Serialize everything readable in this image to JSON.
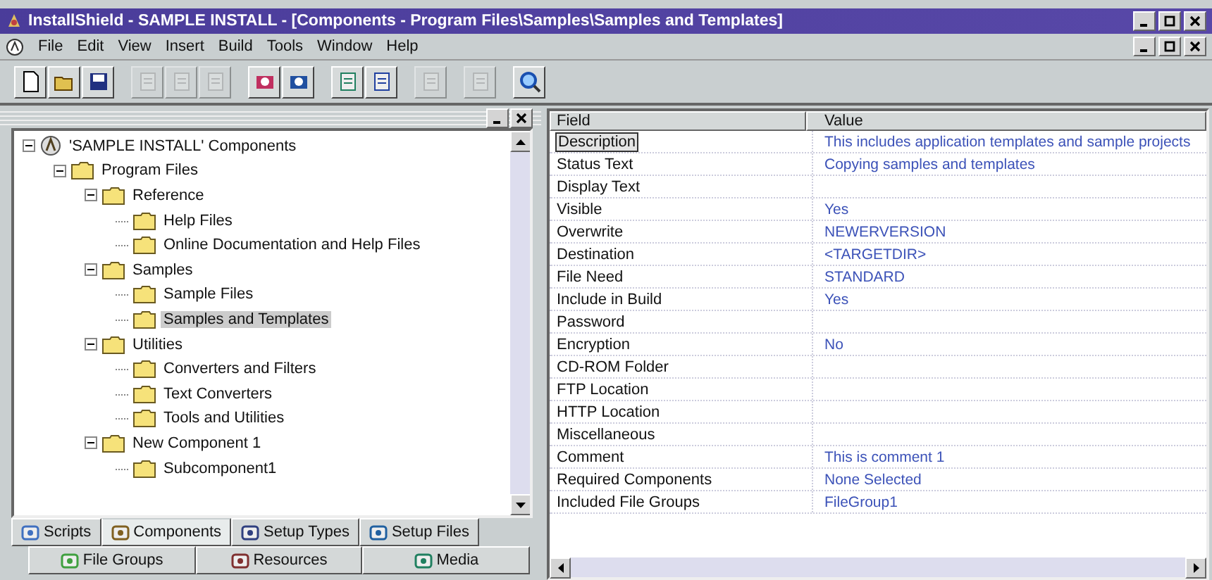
{
  "window": {
    "title": "InstallShield - SAMPLE INSTALL - [Components - Program Files\\Samples\\Samples and Templates]"
  },
  "menu": [
    "File",
    "Edit",
    "View",
    "Insert",
    "Build",
    "Tools",
    "Window",
    "Help"
  ],
  "toolbar": [
    {
      "kind": "new",
      "disabled": false
    },
    {
      "kind": "open",
      "disabled": false
    },
    {
      "kind": "save",
      "disabled": false
    },
    {
      "kind": "cut",
      "disabled": true
    },
    {
      "kind": "copy",
      "disabled": true
    },
    {
      "kind": "paste",
      "disabled": true
    },
    {
      "kind": "compile",
      "disabled": false
    },
    {
      "kind": "build",
      "disabled": false
    },
    {
      "kind": "import",
      "disabled": false
    },
    {
      "kind": "export",
      "disabled": false
    },
    {
      "kind": "wizard",
      "disabled": true
    },
    {
      "kind": "run",
      "disabled": true
    },
    {
      "kind": "search",
      "disabled": false
    }
  ],
  "tree": [
    {
      "label": "'SAMPLE INSTALL' Components",
      "kind": "root",
      "expanded": true,
      "selected": false,
      "children": [
        {
          "label": "Program Files",
          "expanded": true,
          "selected": false,
          "children": [
            {
              "label": "Reference",
              "expanded": true,
              "selected": false,
              "children": [
                {
                  "label": "Help Files",
                  "selected": false
                },
                {
                  "label": "Online Documentation and Help Files",
                  "selected": false
                }
              ]
            },
            {
              "label": "Samples",
              "expanded": true,
              "selected": false,
              "children": [
                {
                  "label": "Sample Files",
                  "selected": false
                },
                {
                  "label": "Samples and Templates",
                  "selected": true
                }
              ]
            },
            {
              "label": "Utilities",
              "expanded": true,
              "selected": false,
              "children": [
                {
                  "label": "Converters and Filters",
                  "selected": false
                },
                {
                  "label": "Text Converters",
                  "selected": false
                },
                {
                  "label": "Tools and Utilities",
                  "selected": false
                }
              ]
            },
            {
              "label": "New Component 1",
              "expanded": true,
              "selected": false,
              "children": [
                {
                  "label": "Subcomponent1",
                  "selected": false
                }
              ]
            }
          ]
        }
      ]
    }
  ],
  "tabs": [
    [
      {
        "label": "Scripts",
        "kind": "scripts",
        "selected": false
      },
      {
        "label": "Components",
        "kind": "components",
        "selected": true
      },
      {
        "label": "Setup Types",
        "kind": "types",
        "selected": false
      },
      {
        "label": "Setup Files",
        "kind": "files",
        "selected": false
      }
    ],
    [
      {
        "label": "File Groups",
        "kind": "groups",
        "selected": false
      },
      {
        "label": "Resources",
        "kind": "resources",
        "selected": false
      },
      {
        "label": "Media",
        "kind": "media",
        "selected": false
      }
    ]
  ],
  "properties": {
    "columns": [
      "Field",
      "Value"
    ],
    "rows": [
      {
        "field": "Description",
        "value": "This includes application templates and sample projects",
        "selected": true
      },
      {
        "field": "Status Text",
        "value": "Copying samples and templates",
        "selected": false
      },
      {
        "field": "Display Text",
        "selected": false
      },
      {
        "field": "Visible",
        "value": "Yes",
        "selected": false
      },
      {
        "field": "Overwrite",
        "value": "NEWERVERSION",
        "selected": false
      },
      {
        "field": "Destination",
        "value": "<TARGETDIR>",
        "selected": false
      },
      {
        "field": "File Need",
        "value": "STANDARD",
        "selected": false
      },
      {
        "field": "Include in Build",
        "value": "Yes",
        "selected": false
      },
      {
        "field": "Password",
        "selected": false
      },
      {
        "field": "Encryption",
        "value": "No",
        "selected": false
      },
      {
        "field": "CD-ROM Folder",
        "selected": false
      },
      {
        "field": "FTP Location",
        "selected": false
      },
      {
        "field": "HTTP Location",
        "selected": false
      },
      {
        "field": "Miscellaneous",
        "selected": false
      },
      {
        "field": "Comment",
        "value": "This is comment 1",
        "selected": false
      },
      {
        "field": "Required Components",
        "value": "None Selected",
        "selected": false
      },
      {
        "field": "Included File Groups",
        "value": "FileGroup1",
        "selected": false
      }
    ]
  }
}
